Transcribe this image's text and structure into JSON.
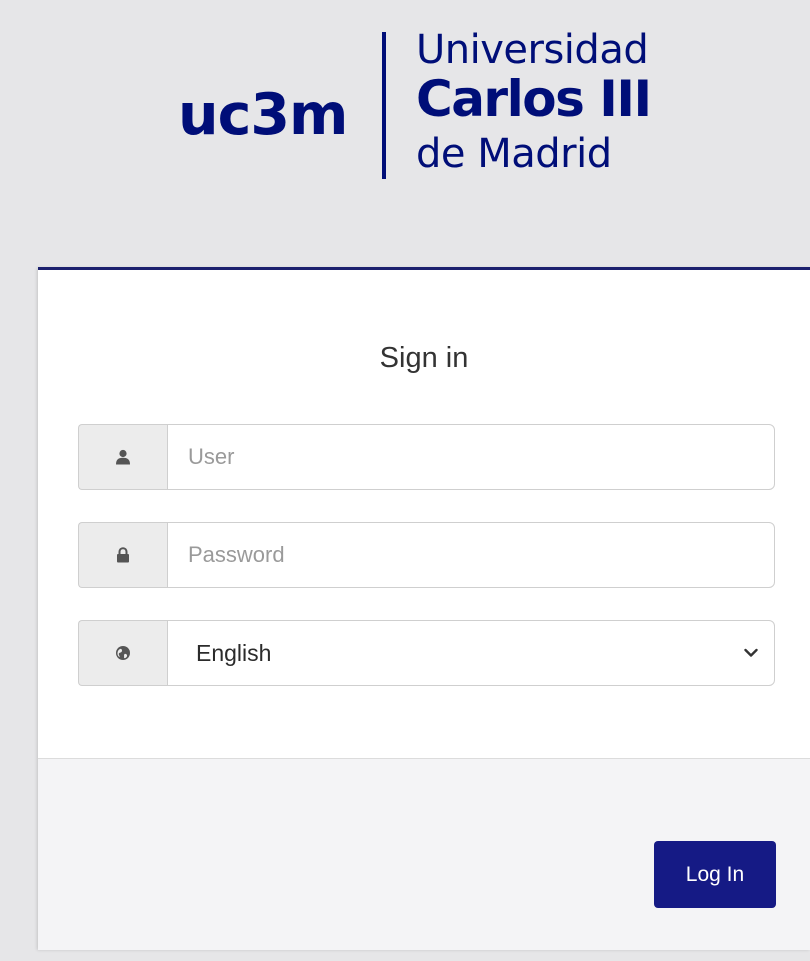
{
  "logo": {
    "mark": "uc3m",
    "line1": "Universidad",
    "line2": "Carlos III",
    "line3": "de Madrid"
  },
  "form": {
    "title": "Sign in",
    "user": {
      "placeholder": "User",
      "value": "",
      "icon": "user-icon"
    },
    "password": {
      "placeholder": "Password",
      "value": "",
      "icon": "lock-icon"
    },
    "language": {
      "selected": "English",
      "icon": "globe-icon"
    },
    "login_label": "Log In"
  },
  "colors": {
    "brand": "#000e78",
    "button": "#151a85",
    "card_top_border": "#1c216e",
    "background": "#e6e6e8"
  }
}
